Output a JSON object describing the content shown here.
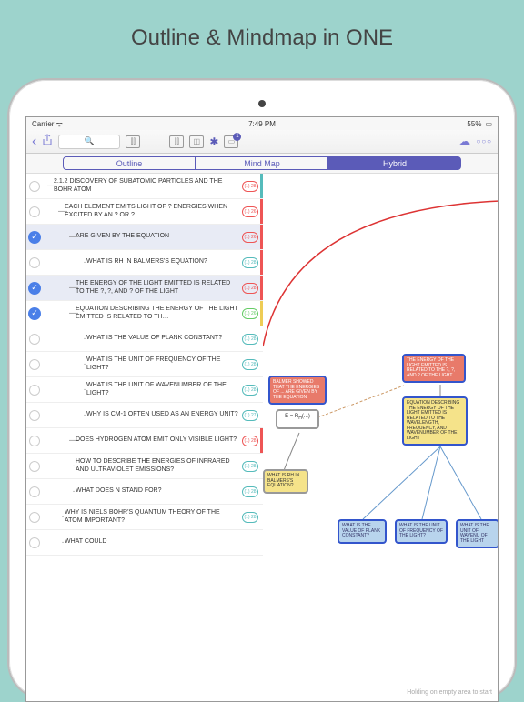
{
  "promo_title": "Outline & Mindmap in ONE",
  "status": {
    "carrier": "Carrier",
    "time": "7:49 PM",
    "battery": "55%"
  },
  "segments": {
    "outline": "Outline",
    "mindmap": "Mind Map",
    "hybrid": "Hybrid"
  },
  "rows": [
    {
      "chk": false,
      "mark": "—",
      "lvl": 1,
      "txt": "2.1.2 DISCOVERY OF SUBATOMIC PARTICLES AND THE BOHR ATOM",
      "cnt": "(1) 28",
      "cc": "red",
      "st": "teal"
    },
    {
      "chk": false,
      "mark": "—",
      "lvl": 2,
      "txt": "EACH ELEMENT EMITS LIGHT OF ? ENERGIES WHEN EXCITED BY AN ? OR ?",
      "cnt": "(1) 26",
      "cc": "red",
      "st": "red"
    },
    {
      "chk": true,
      "mark": "—",
      "lvl": 3,
      "txt": "ARE GIVEN BY THE EQUATION",
      "cnt": "(1) 26",
      "cc": "red",
      "st": "red",
      "sel": true
    },
    {
      "chk": false,
      "mark": "·",
      "lvl": 4,
      "txt": "WHAT IS RH IN BALMERS'S EQUATION?",
      "cnt": "(1) 28",
      "cc": "teal",
      "st": "red"
    },
    {
      "chk": true,
      "mark": "—",
      "lvl": 3,
      "txt": "THE ENERGY OF THE LIGHT EMITTED IS RELATED TO THE ?, ?, AND ? OF THE LIGHT",
      "cnt": "(1) 28",
      "cc": "red",
      "st": "red",
      "sel": true
    },
    {
      "chk": true,
      "mark": "—",
      "lvl": 3,
      "txt": "EQUATION DESCRIBING THE ENERGY OF THE LIGHT EMITTED IS RELATED TO TH…",
      "cnt": "(1) 26",
      "cc": "green",
      "st": "yellow"
    },
    {
      "chk": false,
      "mark": "·",
      "lvl": 4,
      "txt": "WHAT IS THE VALUE OF PLANK CONSTANT?",
      "cnt": "(1) 28",
      "cc": "teal",
      "st": "none"
    },
    {
      "chk": false,
      "mark": "·",
      "lvl": 4,
      "txt": "WHAT IS THE UNIT OF FREQUENCY OF THE LIGHT?",
      "cnt": "(1) 28",
      "cc": "teal",
      "st": "none"
    },
    {
      "chk": false,
      "mark": "·",
      "lvl": 4,
      "txt": "WHAT IS THE UNIT OF WAVENUMBER OF THE LIGHT?",
      "cnt": "(1) 28",
      "cc": "teal",
      "st": "none"
    },
    {
      "chk": false,
      "mark": "·",
      "lvl": 4,
      "txt": "WHY IS CM-1 OFTEN USED AS AN ENERGY UNIT?",
      "cnt": "(1) 27",
      "cc": "teal",
      "st": "none"
    },
    {
      "chk": false,
      "mark": "—",
      "lvl": 3,
      "txt": "DOES HYDROGEN ATOM EMIT ONLY VISIBLE LIGHT?",
      "cnt": "(1) 28",
      "cc": "red",
      "st": "red"
    },
    {
      "chk": false,
      "mark": "·",
      "lvl": 3,
      "txt": "HOW TO DESCRIBE THE ENERGIES OF INFRARED AND ULTRAVIOLET EMISSIONS?",
      "cnt": "(1) 28",
      "cc": "teal",
      "st": "none"
    },
    {
      "chk": false,
      "mark": "·",
      "lvl": 3,
      "txt": "WHAT DOES N STAND FOR?",
      "cnt": "(1) 28",
      "cc": "teal",
      "st": "none"
    },
    {
      "chk": false,
      "mark": "·",
      "lvl": 2,
      "txt": "WHY IS NIELS BOHR'S QUANTUM THEORY OF THE ATOM IMPORTANT?",
      "cnt": "(1) 28",
      "cc": "teal",
      "st": "none"
    },
    {
      "chk": false,
      "mark": "·",
      "lvl": 2,
      "txt": "WHAT COULD",
      "cnt": "",
      "cc": "teal",
      "st": "none"
    }
  ],
  "mm": {
    "n1": "BALMER SHOWED THAT THE ENERGIES OF ... ARE GIVEN BY THE EQUATION",
    "n2": "THE ENERGY OF THE LIGHT EMITTED IS RELATED TO THE ?, ?, AND ? OF THE LIGHT",
    "n3": "EQUATION DESCRIBING THE ENERGY OF THE LIGHT EMITTED IS RELATED TO THE WAVELENGTH, FREQUENCY, AND WAVENUMBER OF THE LIGHT",
    "n4": "WHAT IS RH IN BALMERS'S EQUATION?",
    "n5": "WHAT IS THE VALUE OF PLANK CONSTANT?",
    "n6": "WHAT IS THE UNIT OF FREQUENCY OF THE LIGHT?",
    "n7": "WHAT IS THE UNIT OF WAVENU OF THE LIGHT"
  },
  "hint": "Holding on empty\narea to start"
}
